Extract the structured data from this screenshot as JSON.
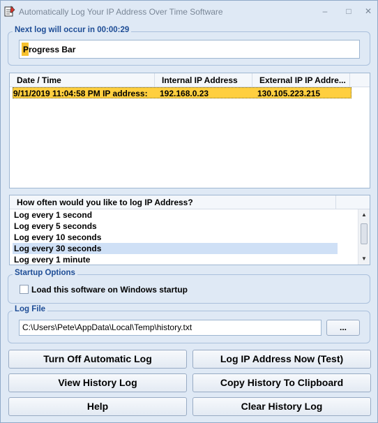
{
  "window": {
    "title": "Automatically Log Your IP Address Over Time Software",
    "minimize_glyph": "–",
    "maximize_glyph": "□",
    "close_glyph": "✕"
  },
  "next_log": {
    "label": "Next log will occur in 00:00:29",
    "progress_text": "Progress Bar",
    "progress_fraction": 0.02
  },
  "log_table": {
    "columns": [
      "Date / Time",
      "Internal IP Address",
      "External IP IP Addre..."
    ],
    "rows": [
      {
        "datetime": "9/11/2019 11:04:58 PM IP address:",
        "internal": "192.168.0.23",
        "external": "130.105.223.215",
        "selected": true
      }
    ]
  },
  "interval_list": {
    "header": "How often would you like to log IP Address?",
    "items": [
      "Log every 1 second",
      "Log every 5 seconds",
      "Log every 10 seconds",
      "Log every 30 seconds",
      "Log every 1 minute"
    ],
    "selected_index": 3
  },
  "startup": {
    "label": "Startup Options",
    "checkbox_label": "Load this software on Windows startup",
    "checked": false
  },
  "log_file": {
    "label": "Log File",
    "path": "C:\\Users\\Pete\\AppData\\Local\\Temp\\history.txt",
    "browse_label": "..."
  },
  "buttons": {
    "turn_off": "Turn Off Automatic Log",
    "log_now": "Log IP Address Now (Test)",
    "view_history": "View History Log",
    "copy_history": "Copy History To Clipboard",
    "help": "Help",
    "clear_history": "Clear History Log"
  },
  "colors": {
    "accent_label": "#1e4d96",
    "selection_row": "#ffcf3f",
    "progress_fill": "#f7c12e",
    "window_bg": "#dfe9f5"
  },
  "icons": {
    "app": "notepad-pencil-icon",
    "scroll_up": "chevron-up-icon",
    "scroll_down": "chevron-down-icon"
  }
}
